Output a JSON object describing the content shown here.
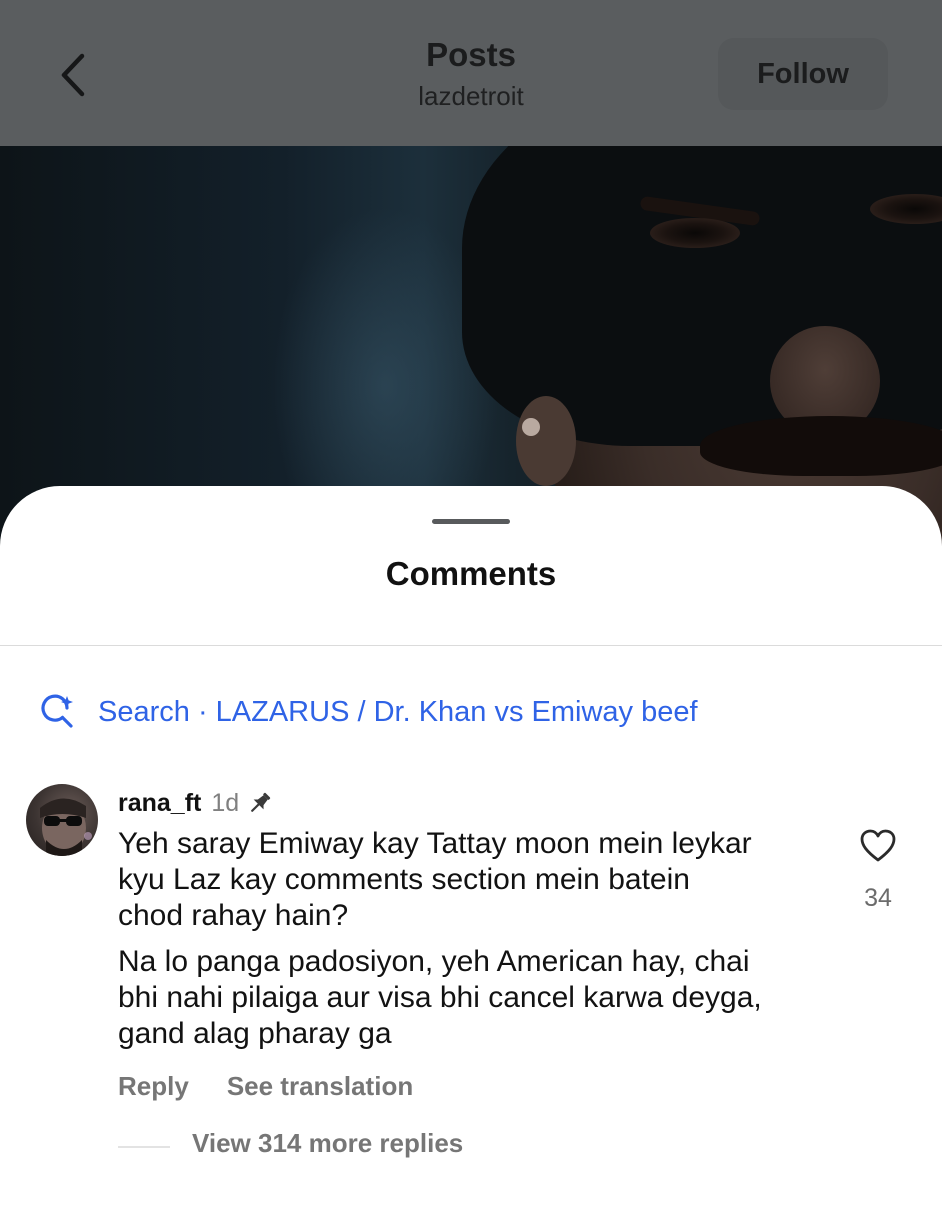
{
  "header": {
    "title": "Posts",
    "subtitle": "lazdetroit",
    "follow_label": "Follow"
  },
  "comments_sheet": {
    "title": "Comments",
    "search_label": "Search · LAZARUS / Dr. Khan vs Emiway beef"
  },
  "comment": {
    "username": "rana_ft",
    "time": "1d",
    "pinned": true,
    "paragraph_1_lines": [
      "Yeh saray Emiway kay Tattay moon mein leykar",
      "kyu Laz kay comments section mein batein",
      "chod rahay hain?"
    ],
    "paragraph_2_lines": [
      "Na lo panga padosiyon, yeh American hay, chai",
      "bhi nahi pilaiga aur visa bhi cancel karwa deyga,",
      "gand alag pharay ga"
    ],
    "like_count": "34",
    "reply_label": "Reply",
    "translate_label": "See translation",
    "view_replies_label": "View 314 more replies"
  },
  "colors": {
    "link_blue": "#2f63e6",
    "muted_text": "#767676",
    "header_dim": "#5a5d5f"
  },
  "icons": [
    "back-chevron-icon",
    "search-sparkle-icon",
    "pin-icon",
    "heart-icon"
  ]
}
